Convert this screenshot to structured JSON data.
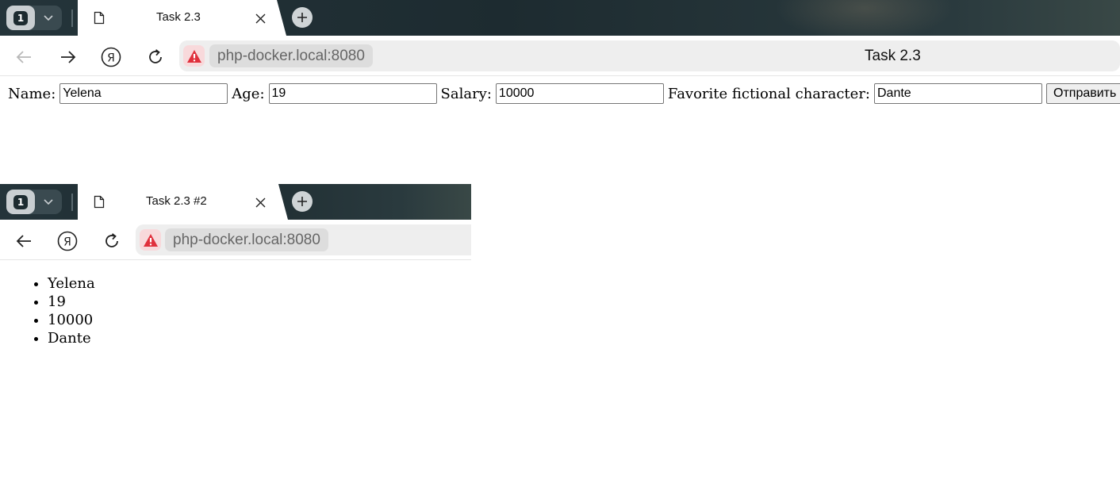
{
  "window1": {
    "tab_count": "1",
    "tab_title": "Task 2.3",
    "url": "php-docker.local:8080",
    "page_title": "Task 2.3"
  },
  "form": {
    "name_label": "Name:",
    "name_value": "Yelena",
    "age_label": "Age:",
    "age_value": "19",
    "salary_label": "Salary:",
    "salary_value": "10000",
    "character_label": "Favorite fictional character:",
    "character_value": "Dante",
    "submit_label": "Отправить"
  },
  "window2": {
    "tab_count": "1",
    "tab_title": "Task 2.3 #2",
    "url": "php-docker.local:8080"
  },
  "results": [
    "Yelena",
    "19",
    "10000",
    "Dante"
  ],
  "icons": {
    "tab": "document-icon",
    "close": "close-icon",
    "new_tab": "plus-icon",
    "back": "arrow-left-icon",
    "forward": "arrow-right-icon",
    "yandex": "yandex-logo-icon",
    "reload": "reload-icon",
    "security": "warning-icon"
  },
  "colors": {
    "tabbar_bg": "#1d2b30",
    "warning": "#e0303c",
    "address_bg": "#eeeeee"
  }
}
